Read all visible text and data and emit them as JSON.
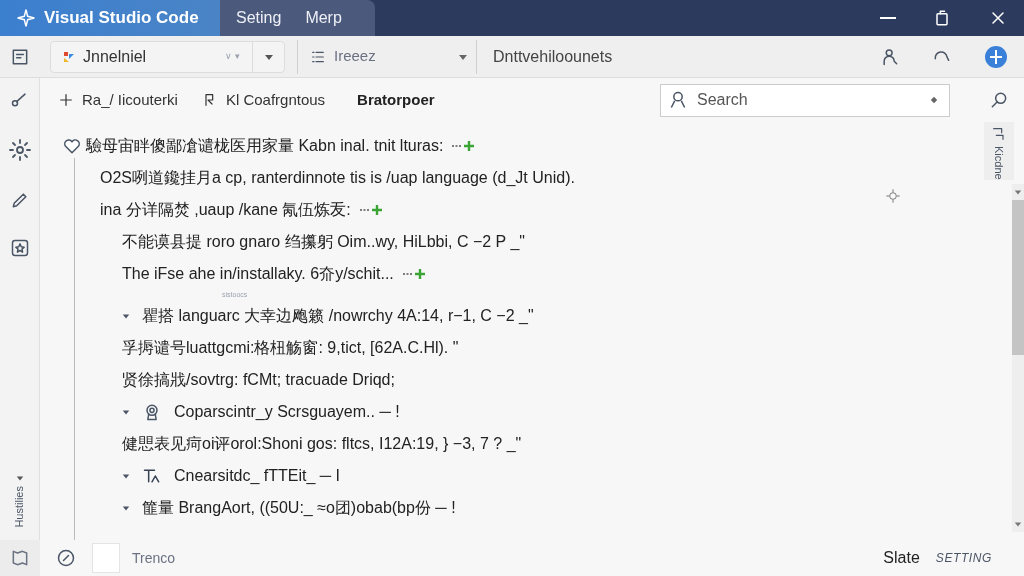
{
  "window": {
    "title": "Visual Studio Code",
    "tabs": [
      {
        "label": "Seting",
        "selected": false
      },
      {
        "label": "Merp",
        "selected": false
      }
    ]
  },
  "toolbar": {
    "project": {
      "value": "Jnnelniel",
      "hint": "∨ ▾"
    },
    "branch": {
      "value": "Ireeez"
    },
    "path": "Dnttvehiloounets"
  },
  "actions": [
    {
      "label": "Ra_/ Iicouterki",
      "kind": "add",
      "bold": false
    },
    {
      "label": "Kl Coafrgntous",
      "kind": "back",
      "bold": false
    },
    {
      "label": "Bratorpoer",
      "bold": true
    }
  ],
  "search": {
    "placeholder": "Search"
  },
  "right_tab": "Kicdne",
  "side_label": "Hustilies",
  "tree": [
    {
      "text": "驗母宙眫傻鄙凔谴栊医用家量 Kabn inal. tnit lturas:",
      "kind": "heart",
      "add": true,
      "children": [
        {
          "text": "O2S咧道鑱挂月a cp, ranterdinnote tis is /uap language (d_Jt Unid).",
          "add": false
        },
        {
          "text": "ina 分详隔焚 ,uaup /kane 氝伍炼叐:",
          "add": true,
          "children": [
            {
              "text": "不能谟县提 rorо gnaro 绉攥躬 Oim..wy, HiLbbi, C −2 P _\"",
              "add": false
            },
            {
              "text": "The iFse ahe in/installaky. 6夼y/schit...",
              "add": true
            },
            {
              "text": "瞿搭 languarc 大幸边飑籁 /nowrchy 4A:14, r−1, C −2 _\"",
              "kind": "caret",
              "add": false,
              "note": "sistoocs"
            },
            {
              "text": "孚搙谴号luattgcmi:格杻觞窗: 9,tict, [62A.C.Hl). \"",
              "add": false
            },
            {
              "text": "贤徐搞戕/sovtrg: fCMt; tracuade Driqd;",
              "add": false
            },
            {
              "text": "Coparscintr_y Scrsguayem.. ─ !",
              "kind": "badge",
              "add": false
            },
            {
              "text": "健愳表见疴oi评orol:Shoni gos: fltcs, I12A:19, } −3, 7 ? _\"",
              "add": false
            },
            {
              "text": "Cnearsitdc_ fTTEit_ ─ I",
              "kind": "tool",
              "add": false
            },
            {
              "text": "篚量 BrangAort, ((50U:_ ≈o团)obab(bp份 ─ !",
              "kind": "caret",
              "add": false
            }
          ]
        }
      ]
    }
  ],
  "status_bar": {
    "left": "Trenco",
    "right": "Slate",
    "mode": "SETTING"
  }
}
